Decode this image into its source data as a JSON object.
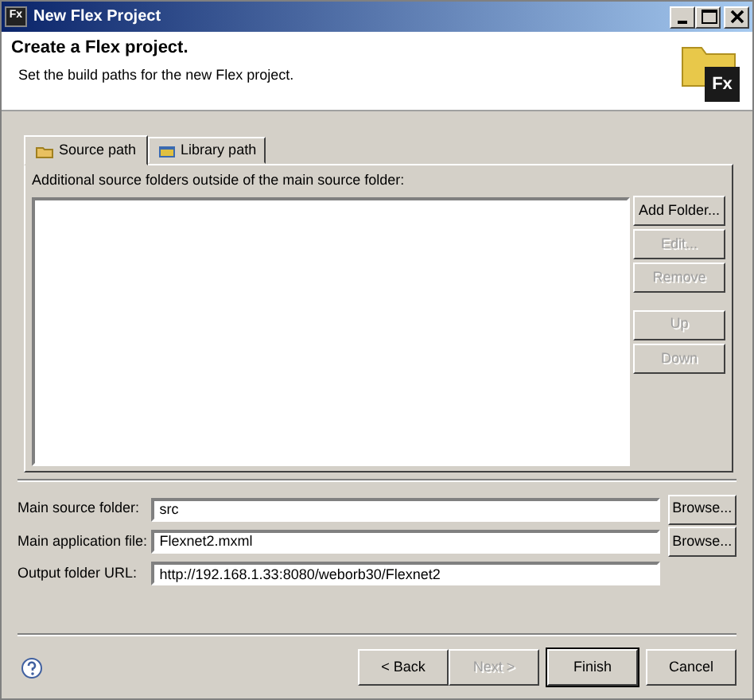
{
  "window": {
    "title": "New Flex Project",
    "app_badge": "Fx"
  },
  "logo": {
    "text": "Fx"
  },
  "header": {
    "title": "Create a Flex project.",
    "description": "Set the build paths for the new Flex project."
  },
  "tabs": [
    {
      "label": "Source path",
      "selected": true
    },
    {
      "label": "Library path",
      "selected": false
    }
  ],
  "source_path": {
    "caption": "Additional source folders outside of the main source folder:",
    "buttons": [
      {
        "label": "Add Folder...",
        "disabled": false
      },
      {
        "label": "Edit...",
        "disabled": true
      },
      {
        "label": "Remove",
        "disabled": true
      },
      {
        "label": "Up",
        "disabled": true
      },
      {
        "label": "Down",
        "disabled": true
      }
    ]
  },
  "fields": [
    {
      "label": "Main source folder:",
      "value": "src",
      "browse": "Browse..."
    },
    {
      "label": "Main application file:",
      "value": "Flexnet2.mxml",
      "browse": "Browse..."
    },
    {
      "label": "Output folder URL:",
      "value": "http://192.168.1.33:8080/weborb30/Flexnet2"
    }
  ],
  "footer": {
    "buttons": [
      {
        "label": "< Back",
        "disabled": false,
        "default": false
      },
      {
        "label": "Next >",
        "disabled": true,
        "default": false
      },
      {
        "label": "Finish",
        "disabled": false,
        "default": true
      },
      {
        "label": "Cancel",
        "disabled": false,
        "default": false
      }
    ]
  }
}
